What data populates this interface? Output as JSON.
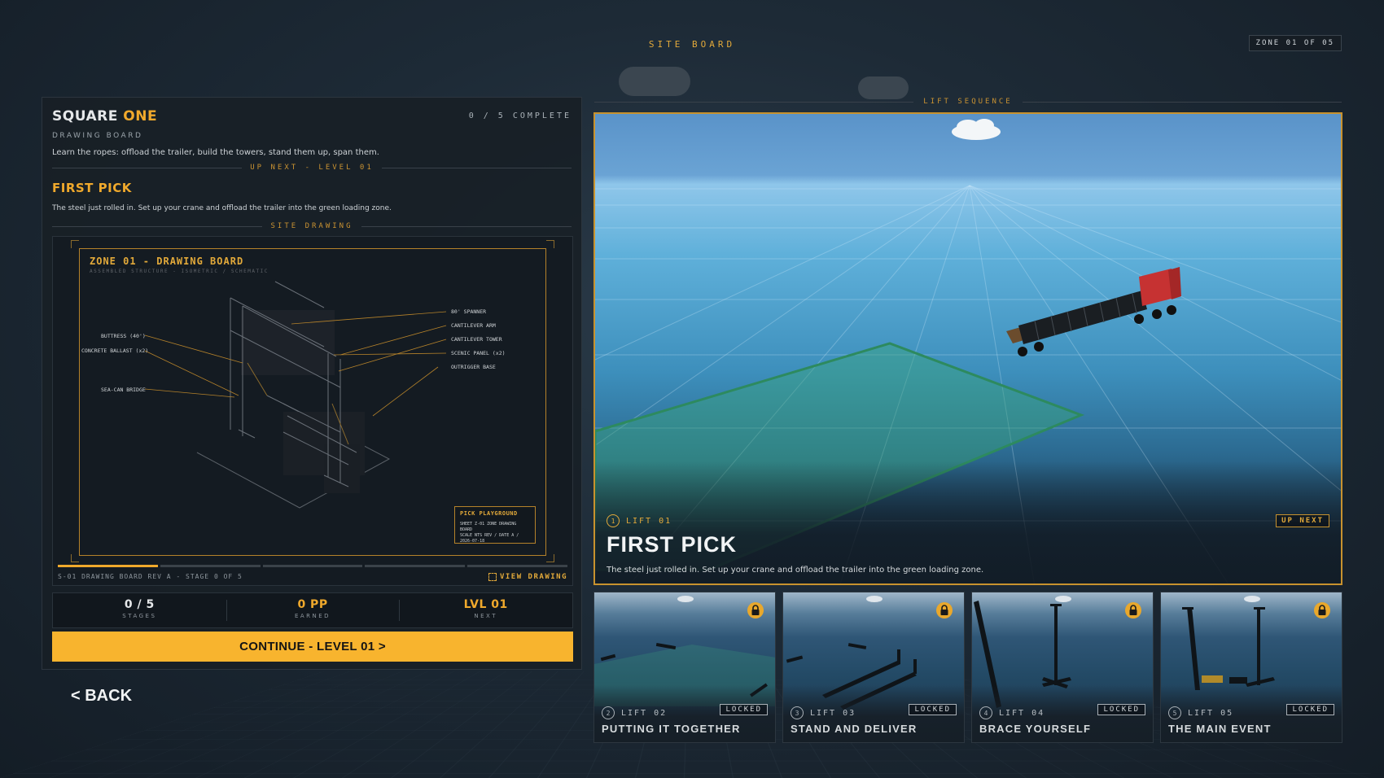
{
  "header": {
    "title": "SITE BOARD",
    "zone_badge": "ZONE 01 OF 05"
  },
  "left_panel": {
    "title_main": "SQUARE",
    "title_accent": "ONE",
    "progress": "0 / 5 COMPLETE",
    "subtitle": "DRAWING BOARD",
    "description": "Learn the ropes: offload the trailer, build the towers, stand them up, span them.",
    "up_next_label": "UP NEXT - LEVEL 01",
    "level_title": "FIRST PICK",
    "level_description": "The steel just rolled in. Set up your crane and offload the trailer into the green loading zone.",
    "site_drawing_label": "SITE DRAWING",
    "drawing": {
      "title": "ZONE 01 - DRAWING BOARD",
      "subtitle": "ASSEMBLED STRUCTURE - ISOMETRIC / SCHEMATIC",
      "callouts_left": [
        "BUTTRESS (40')",
        "CONCRETE BALLAST (x2)",
        "SEA-CAN BRIDGE"
      ],
      "callouts_right": [
        "80' SPANNER",
        "CANTILEVER ARM",
        "CANTILEVER TOWER",
        "SCENIC PANEL (x2)",
        "OUTRIGGER BASE"
      ],
      "pick_box_title": "PICK PLAYGROUND",
      "pick_box_rows": [
        "SHEET  Z-01   ZONE  DRAWING BOARD",
        "SCALE  NTS    REV / DATE  A / 2026-07-18"
      ],
      "stage_progress": 0.2,
      "caption": "S-01 DRAWING BOARD  REV A - STAGE 0 OF 5",
      "view_button": "VIEW DRAWING"
    },
    "stats": [
      {
        "value": "0 / 5",
        "label": "STAGES"
      },
      {
        "value": "0 PP",
        "label": "EARNED"
      },
      {
        "value": "LVL 01",
        "label": "NEXT"
      }
    ],
    "continue_button": "CONTINUE - LEVEL 01 >",
    "back_button": "< BACK"
  },
  "lift_sequence_label": "LIFT SEQUENCE",
  "hero": {
    "lift_number": "1",
    "lift_label": "LIFT 01",
    "title": "FIRST PICK",
    "description": "The steel just rolled in. Set up your crane and offload the trailer into the green loading zone.",
    "badge": "UP NEXT"
  },
  "cards": [
    {
      "number": "2",
      "lift_label": "LIFT 02",
      "status": "LOCKED",
      "title": "PUTTING IT TOGETHER"
    },
    {
      "number": "3",
      "lift_label": "LIFT 03",
      "status": "LOCKED",
      "title": "STAND AND DELIVER"
    },
    {
      "number": "4",
      "lift_label": "LIFT 04",
      "status": "LOCKED",
      "title": "BRACE YOURSELF"
    },
    {
      "number": "5",
      "lift_label": "LIFT 05",
      "status": "LOCKED",
      "title": "THE MAIN EVENT"
    }
  ],
  "icons": {
    "lock": "lock-icon",
    "expand": "expand-icon",
    "cloud": "cloud-icon"
  },
  "colors": {
    "accent": "#f0a92c",
    "button": "#f8b42e",
    "panel": "#181f26",
    "loading_zone": "#3aa57a"
  }
}
